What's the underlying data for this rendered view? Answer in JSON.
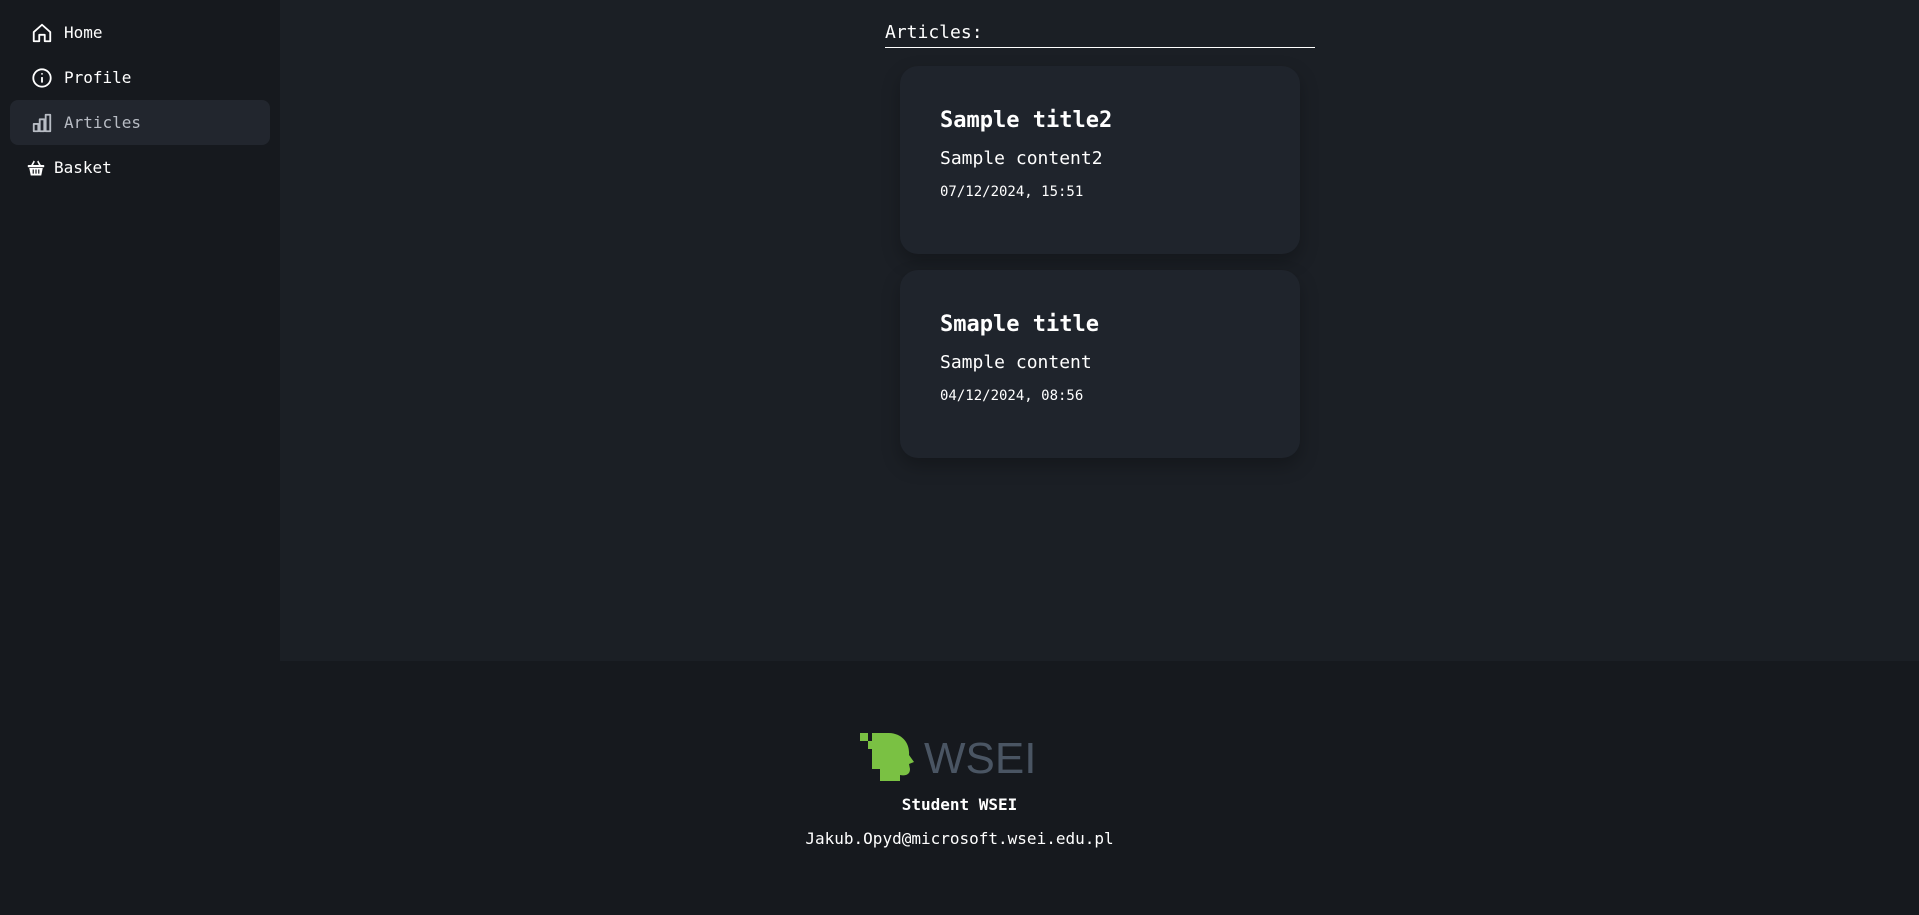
{
  "sidebar": {
    "items": [
      {
        "label": "Home",
        "icon": "home-icon",
        "active": false
      },
      {
        "label": "Profile",
        "icon": "info-icon",
        "active": false
      },
      {
        "label": "Articles",
        "icon": "bar-chart-icon",
        "active": true
      },
      {
        "label": "Basket",
        "icon": "basket-icon",
        "active": false
      }
    ]
  },
  "main": {
    "heading": "Articles:",
    "articles": [
      {
        "title": "Sample title2",
        "content": "Sample content2",
        "date": "07/12/2024, 15:51"
      },
      {
        "title": "Smaple title",
        "content": "Sample content",
        "date": "04/12/2024, 08:56"
      }
    ]
  },
  "footer": {
    "logo_text": "WSEI",
    "name": "Student WSEI",
    "email": "Jakub.Opyd@microsoft.wsei.edu.pl"
  },
  "colors": {
    "background": "#16191e",
    "main_background": "#1b1f25",
    "card_background": "#1f242c",
    "active_nav": "#22262e",
    "logo_green": "#7ac143",
    "logo_gray": "#4a5563"
  }
}
